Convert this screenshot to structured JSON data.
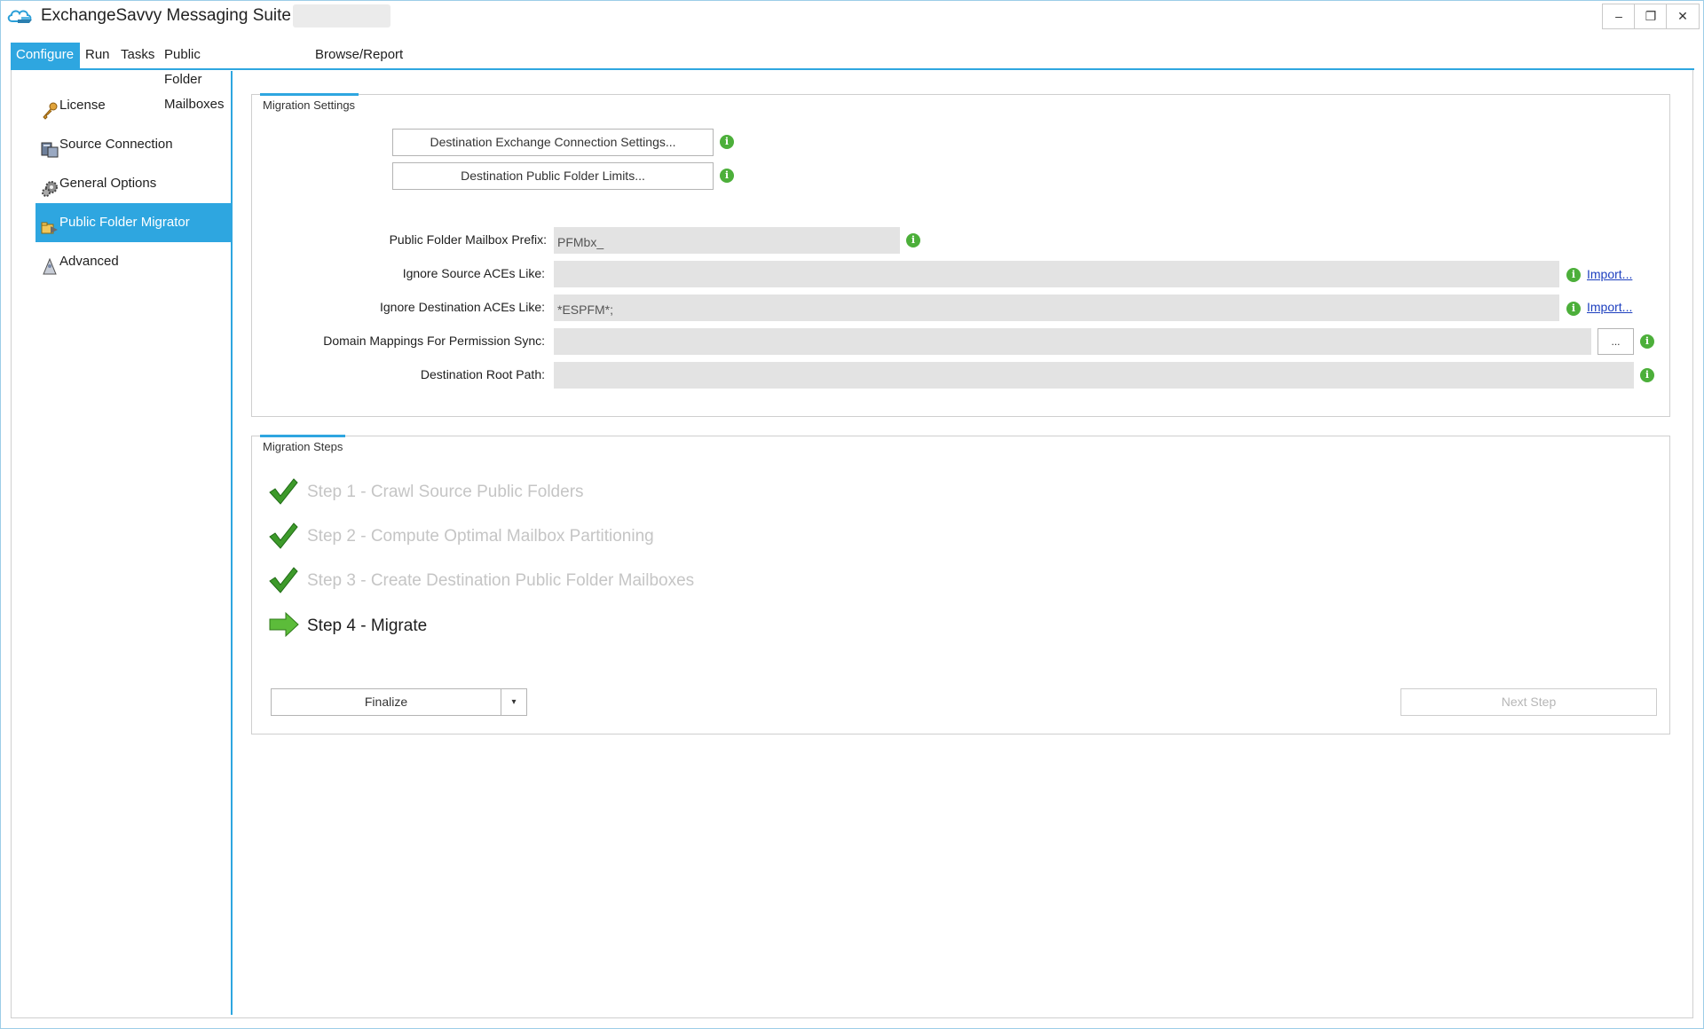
{
  "window": {
    "title": "ExchangeSavvy Messaging Suite -",
    "minimize_glyph": "–",
    "maximize_glyph": "❐",
    "close_glyph": "✕"
  },
  "tabs": [
    {
      "label": "Configure",
      "active": true
    },
    {
      "label": "Run",
      "active": false
    },
    {
      "label": "Tasks",
      "active": false
    },
    {
      "label": "Public Folder Mailboxes",
      "active": false
    },
    {
      "label": "Browse/Report",
      "active": false
    }
  ],
  "sidebar": {
    "items": [
      {
        "label": "License",
        "icon": "key-icon",
        "selected": false
      },
      {
        "label": "Source Connection",
        "icon": "server-icon",
        "selected": false
      },
      {
        "label": "General Options",
        "icon": "gears-icon",
        "selected": false
      },
      {
        "label": "Public Folder Migrator",
        "icon": "migrator-icon",
        "selected": true
      },
      {
        "label": "Advanced",
        "icon": "wizard-icon",
        "selected": false
      }
    ]
  },
  "migration_settings": {
    "caption": "Migration Settings",
    "dest_connection_button": "Destination Exchange Connection Settings...",
    "dest_limits_button": "Destination Public Folder Limits...",
    "fields": {
      "mailbox_prefix": {
        "label": "Public Folder Mailbox Prefix:",
        "value": "PFMbx_"
      },
      "ignore_source_aces": {
        "label": "Ignore Source ACEs Like:",
        "value": ""
      },
      "ignore_dest_aces": {
        "label": "Ignore Destination ACEs Like:",
        "value": "*ESPFM*;"
      },
      "domain_mappings": {
        "label": "Domain Mappings For Permission Sync:",
        "value": ""
      },
      "dest_root_path": {
        "label": "Destination Root Path:",
        "value": ""
      }
    },
    "import_link": "Import...",
    "browse_button": "...",
    "info_glyph": "i"
  },
  "migration_steps": {
    "caption": "Migration Steps",
    "steps": [
      {
        "label": "Step 1 - Crawl Source Public Folders",
        "status": "done"
      },
      {
        "label": "Step 2 - Compute Optimal Mailbox Partitioning",
        "status": "done"
      },
      {
        "label": "Step 3 - Create Destination Public Folder Mailboxes",
        "status": "done"
      },
      {
        "label": "Step 4 - Migrate",
        "status": "current"
      }
    ],
    "finalize_button": "Finalize",
    "dropdown_glyph": "▾",
    "next_step_button": "Next Step"
  },
  "colors": {
    "accent": "#2ea6e0",
    "info_green": "#4caf3a",
    "check_green": "#3d9a2a",
    "link_blue": "#1d3fbf"
  }
}
